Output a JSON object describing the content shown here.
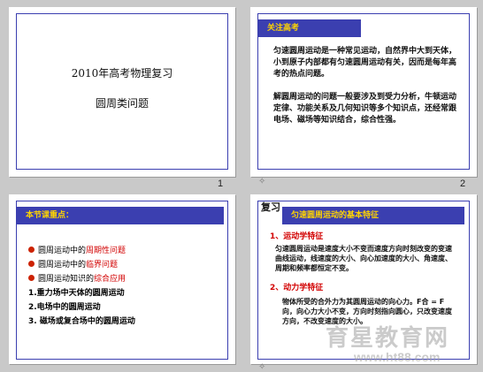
{
  "slides": [
    {
      "page": "1",
      "title_line1": "2010年高考物理复习",
      "title_line2": "圆周类问题"
    },
    {
      "page": "2",
      "header": "关注高考",
      "para1": "匀速圆周运动是一种常见运动，自然界中大到天体，小到原子内部都有匀速圆周运动有关，因而是每年高考的热点问题。",
      "para2": "解圆周运动的问题一般要涉及到受力分析，牛顿运动定律、功能关系及几何知识等多个知识点，还经常跟电场、磁场等知识结合，综合性强。",
      "star": "✧"
    },
    {
      "page": "3",
      "header": "本节课重点：",
      "bullets": [
        {
          "prefix": "圆周运动中的",
          "highlight": "周期性问题"
        },
        {
          "prefix": "圆周运动中的",
          "highlight": "临界问题"
        },
        {
          "prefix": "圆周运动知识的",
          "highlight": "综合应用"
        }
      ],
      "numbered": [
        "1.重力场中天体的圆周运动",
        "2.电场中的圆周运动",
        "3. 磁场或复合场中的圆周运动"
      ]
    },
    {
      "page": "4",
      "tag": "复习",
      "header": "匀速圆周运动的基本特征",
      "sec1_title": "1、运动学特征",
      "sec1_body": "匀速圆周运动是速度大小不变而速度方向时刻改变的变速曲线运动，线速度的大小、向心加速度的大小、角速度、周期和频率都恒定不变。",
      "sec2_title": "2、动力学特征",
      "sec2_body": "物体所受的合外力为其圆周运动的向心力。F合 = F向，向心力大小不变，方向时刻指向圆心，只改变速度方向，不改变速度的大小。",
      "star": "✧"
    }
  ],
  "watermark": {
    "line1": "育星教育网",
    "line2": "www.ht88.com"
  }
}
